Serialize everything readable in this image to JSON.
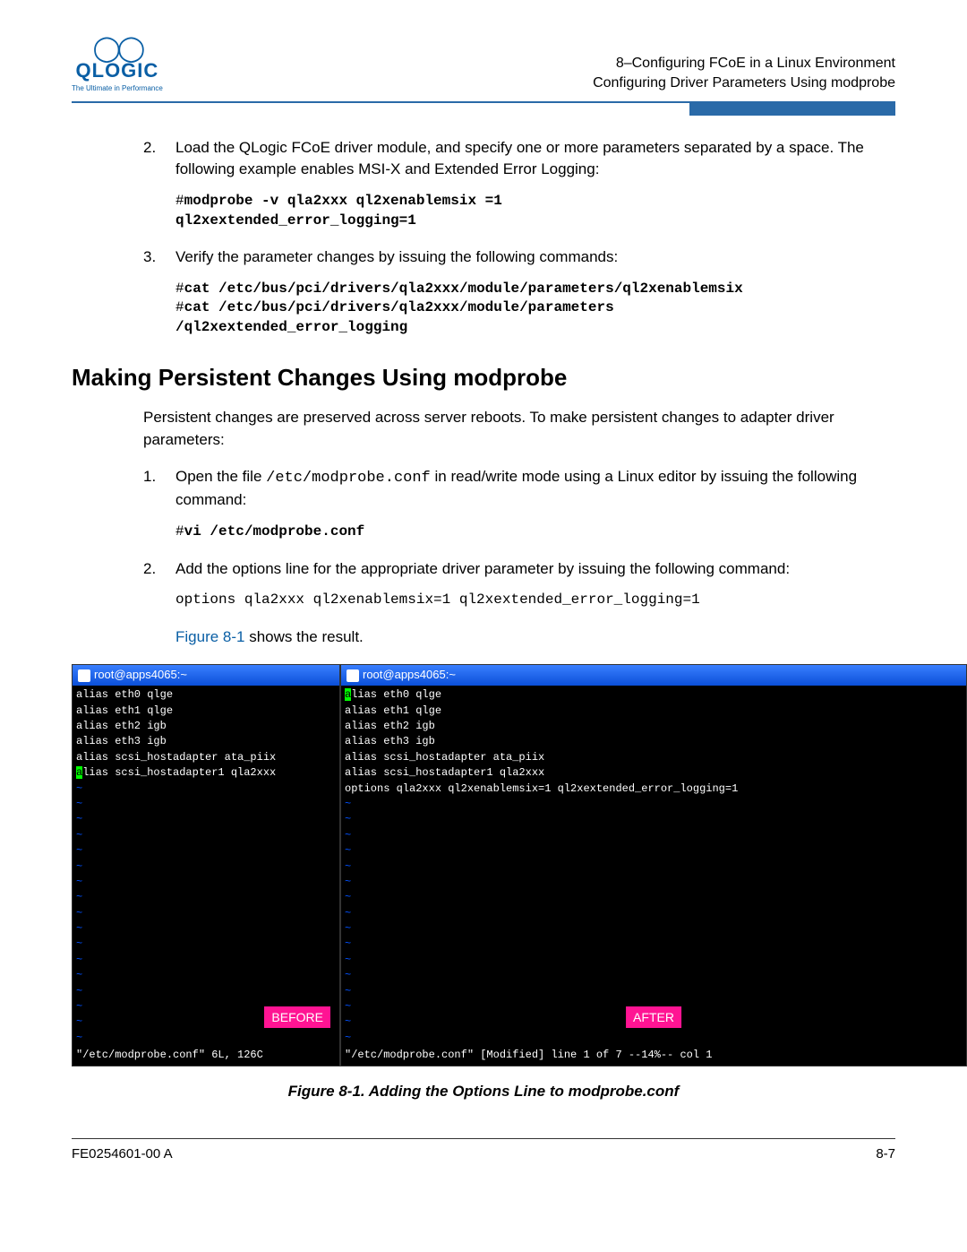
{
  "logo": {
    "brand": "QLOGIC",
    "tagline": "The Ultimate in Performance"
  },
  "header": {
    "line1": "8–Configuring FCoE in a Linux Environment",
    "line2": "Configuring Driver Parameters Using modprobe"
  },
  "steps_a": {
    "s2": {
      "num": "2.",
      "text": "Load the QLogic FCoE driver module, and specify one or more parameters separated by a space. The following example enables MSI-X and Extended Error Logging:",
      "code1_hash": "#",
      "code1_bold": "modprobe -v qla2xxx ql2xenablemsix =1",
      "code2_bold": "ql2xextended_error_logging=1"
    },
    "s3": {
      "num": "3.",
      "text": "Verify the parameter changes by issuing the following commands:",
      "code1_hash": "#",
      "code1_bold": "cat /etc/bus/pci/drivers/qla2xxx/module/parameters/ql2xenablemsix",
      "code2_hash": "#",
      "code2_bold": "cat /etc/bus/pci/drivers/qla2xxx/module/parameters",
      "code3_bold": "/ql2xextended_error_logging"
    }
  },
  "section_heading": "Making Persistent Changes Using modprobe",
  "intro": "Persistent changes are preserved across server reboots. To make persistent changes to adapter driver parameters:",
  "steps_b": {
    "s1": {
      "num": "1.",
      "pre": "Open the file ",
      "file": "/etc/modprobe.conf",
      "post": " in read/write mode using a Linux editor by issuing the following command:",
      "code_hash": "#",
      "code_bold": "vi /etc/modprobe.conf"
    },
    "s2": {
      "num": "2.",
      "text": "Add the options line for the appropriate driver parameter by issuing the following command:",
      "code": "options qla2xxx ql2xenablemsix=1 ql2xextended_error_logging=1"
    },
    "figref": "Figure 8-1",
    "figref_post": " shows the result."
  },
  "terminal": {
    "title": "root@apps4065:~",
    "before_lines": [
      "alias eth0 qlge",
      "alias eth1 qlge",
      "alias eth2 igb",
      "alias eth3 igb",
      "alias scsi_hostadapter ata_piix"
    ],
    "before_hl_char": "a",
    "before_hl_rest": "lias scsi_hostadapter1 qla2xxx",
    "before_status": "\"/etc/modprobe.conf\" 6L, 126C",
    "before_label": "BEFORE",
    "after_hl_char": "a",
    "after_hl_rest": "lias eth0 qlge",
    "after_lines": [
      "alias eth1 qlge",
      "alias eth2 igb",
      "alias eth3 igb",
      "alias scsi_hostadapter ata_piix",
      "alias scsi_hostadapter1 qla2xxx",
      "options qla2xxx ql2xenablemsix=1 ql2xextended_error_logging=1"
    ],
    "after_status": "\"/etc/modprobe.conf\" [Modified] line 1 of 7 --14%-- col 1",
    "after_label": "AFTER"
  },
  "figure_caption": "Figure 8-1. Adding the Options Line to modprobe.conf",
  "footer": {
    "left": "FE0254601-00 A",
    "right": "8-7"
  }
}
